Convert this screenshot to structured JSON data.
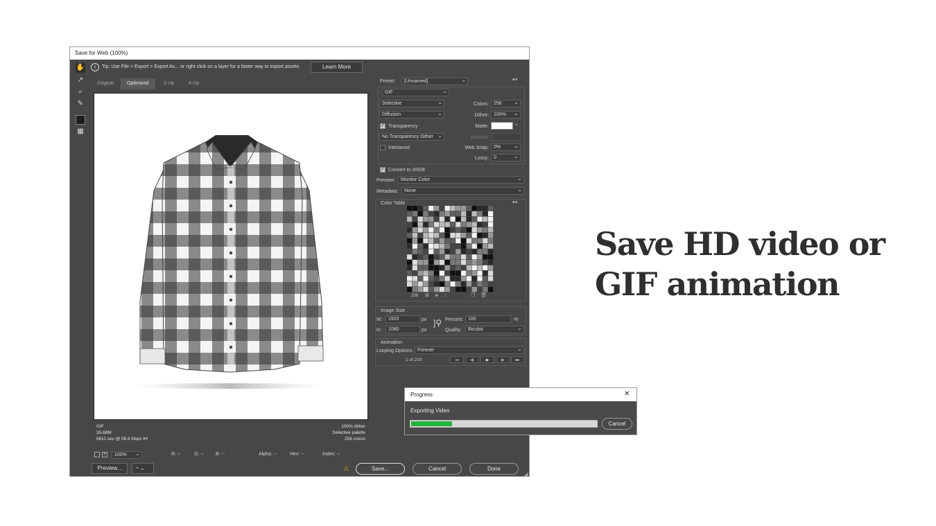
{
  "dialog": {
    "title": "Save for Web (100%)",
    "tip_text": "Tip: Use File > Export > Export As...   or right click on a layer for a faster way to export assets",
    "learn_more": "Learn More",
    "tabs": [
      "Original",
      "Optimized",
      "2-Up",
      "4-Up"
    ],
    "active_tab": "Optimized",
    "image_info": {
      "format": "GIF",
      "size": "35.68M",
      "time": "6611 sec @ 56.6 Kbps",
      "time_suffix": "▾≡",
      "dither": "100% dither",
      "palette": "Selective palette",
      "colors": "256 colors"
    },
    "statusbar": {
      "zoom": "100%",
      "r": "R: --",
      "g": "G: --",
      "b": "B: --",
      "alpha": "Alpha: --",
      "hex": "Hex: --",
      "index": "Index: --"
    },
    "buttons": {
      "preview": "Preview...",
      "save": "Save...",
      "cancel": "Cancel",
      "done": "Done"
    },
    "settings": {
      "preset_label": "Preset:",
      "preset_value": "[Unnamed]",
      "format": "GIF",
      "reduction": "Selective",
      "dither_algo": "Diffusion",
      "transparency_label": "Transparency",
      "transparency_dither": "No Transparency Dither",
      "interlaced_label": "Interlaced",
      "colors_label": "Colors:",
      "colors_value": "256",
      "dither_label": "Dither:",
      "dither_value": "100%",
      "matte_label": "Matte:",
      "amount_label": "Amount:",
      "websnap_label": "Web Snap:",
      "websnap_value": "0%",
      "lossy_label": "Lossy:",
      "lossy_value": "0",
      "srgb_label": "Convert to sRGB",
      "preview_label": "Preview:",
      "preview_value": "Monitor Color",
      "metadata_label": "Metadata:",
      "metadata_value": "None"
    },
    "color_table": {
      "title": "Color Table",
      "count": "256"
    },
    "image_size": {
      "title": "Image Size",
      "w_label": "W:",
      "w_value": "1920",
      "h_label": "H:",
      "h_value": "1080",
      "unit": "px",
      "percent_label": "Percent:",
      "percent_value": "100",
      "percent_unit": "%",
      "quality_label": "Quality:",
      "quality_value": "Bicubic"
    },
    "animation": {
      "title": "Animation",
      "looping_label": "Looping Options:",
      "looping_value": "Forever",
      "frame": "1 of 210"
    }
  },
  "progress": {
    "title": "Progress",
    "message": "Exporting Video",
    "fraction": 0.22,
    "cancel": "Cancel",
    "close_glyph": "✕"
  },
  "headline": {
    "line1": "Save HD video or",
    "line2": "GIF animation"
  }
}
